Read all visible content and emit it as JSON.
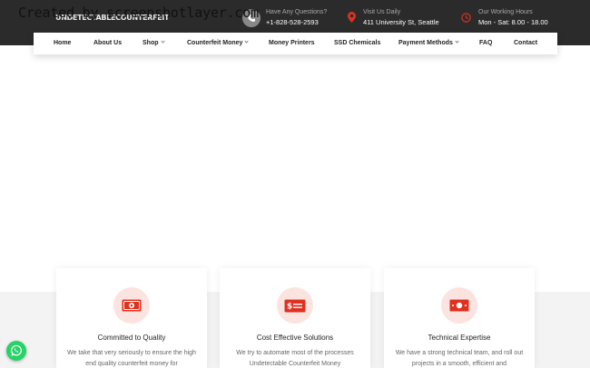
{
  "header": {
    "logo_text": "UNDETECTABLECOUNTERFEIT",
    "watermark": "Created by screenshotlayer.com",
    "contacts": [
      {
        "label": "Have Any Questions?",
        "value": "+1-828-528-2593",
        "icon": "phone-icon"
      },
      {
        "label": "Visit Us Daily",
        "value": "411 University St, Seattle",
        "icon": "location-pin-icon"
      },
      {
        "label": "Our Working Hours",
        "value": "Mon - Sat: 8.00 - 18.00",
        "icon": "clock-icon"
      }
    ]
  },
  "nav": {
    "items": [
      {
        "label": "Home"
      },
      {
        "label": "About Us"
      },
      {
        "label": "Shop",
        "dropdown": true
      },
      {
        "label": "Counterfeit Money",
        "dropdown": true
      },
      {
        "label": "Money Printers"
      },
      {
        "label": "SSD Chemicals"
      },
      {
        "label": "Payment Methods",
        "dropdown": true
      },
      {
        "label": "FAQ"
      },
      {
        "label": "Contact"
      }
    ]
  },
  "features": [
    {
      "title": "Committed to Quality",
      "text": "We take that very seriously to ensure the high end quality counterfeit money for",
      "icon": "money-bill-icon"
    },
    {
      "title": "Cost Effective Solutions",
      "text": "We try to automate most of the processes Undetectable Counterfeit Money",
      "icon": "dollar-card-icon"
    },
    {
      "title": "Technical Expertise",
      "text": "We have a strong technical team, and roll out projects in a smooth, efficient and",
      "icon": "cash-icon"
    }
  ],
  "colors": {
    "accent": "#e0311f",
    "topbar": "#2b2b2b",
    "whatsapp": "#25d366"
  }
}
